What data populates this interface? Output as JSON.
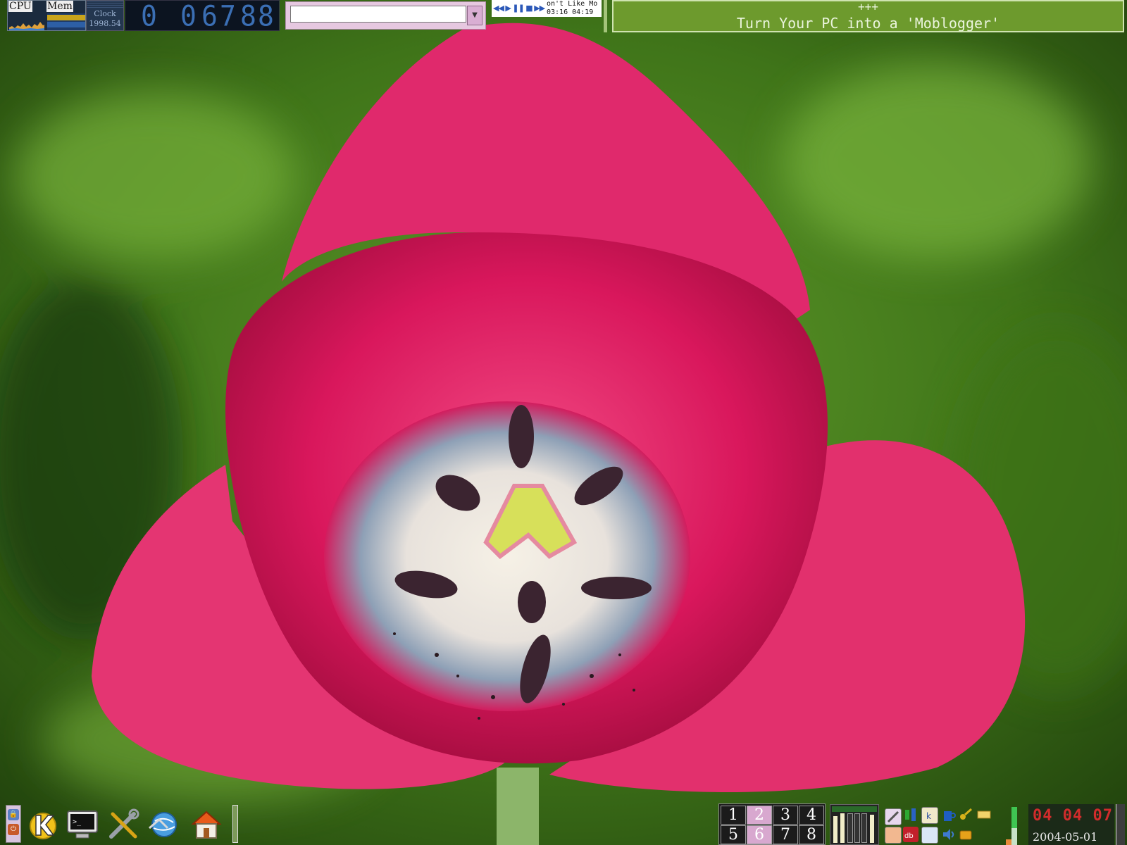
{
  "top_panel": {
    "sysmon": {
      "cpu_label": "CPU",
      "mem_label": "Mem"
    },
    "clock_widget": {
      "label": "Clock",
      "value": "1998.54"
    },
    "digital_counter": {
      "digits": [
        "0",
        "0",
        "6",
        "7",
        "8",
        "8"
      ]
    },
    "command_box": {
      "value": "",
      "placeholder": ""
    },
    "media_player": {
      "controls": "◀◀ ▶ ❚❚ ■ ▶▶",
      "track_title": "on't Like Mo",
      "elapsed": "03:16",
      "total": "04:19"
    },
    "news_ticker": {
      "line1": "+++",
      "line2": "Turn Your PC into a 'Moblogger'"
    }
  },
  "bottom_panel": {
    "launchers": [
      {
        "name": "k-menu-icon"
      },
      {
        "name": "terminal-icon"
      },
      {
        "name": "settings-icon"
      },
      {
        "name": "browser-icon"
      },
      {
        "name": "home-folder-icon"
      }
    ],
    "pager": {
      "desktops": [
        "1",
        "2",
        "3",
        "4",
        "5",
        "6",
        "7",
        "8"
      ],
      "active": [
        "2",
        "6"
      ]
    },
    "clock": {
      "time": "04 04 07",
      "date": "2004-05-01"
    }
  },
  "colors": {
    "ticker_bg": "#6d9a2d",
    "counter_digits": "#3b6fb4",
    "clock_red": "#d12c2c",
    "pager_active": "#d8a8cf"
  }
}
